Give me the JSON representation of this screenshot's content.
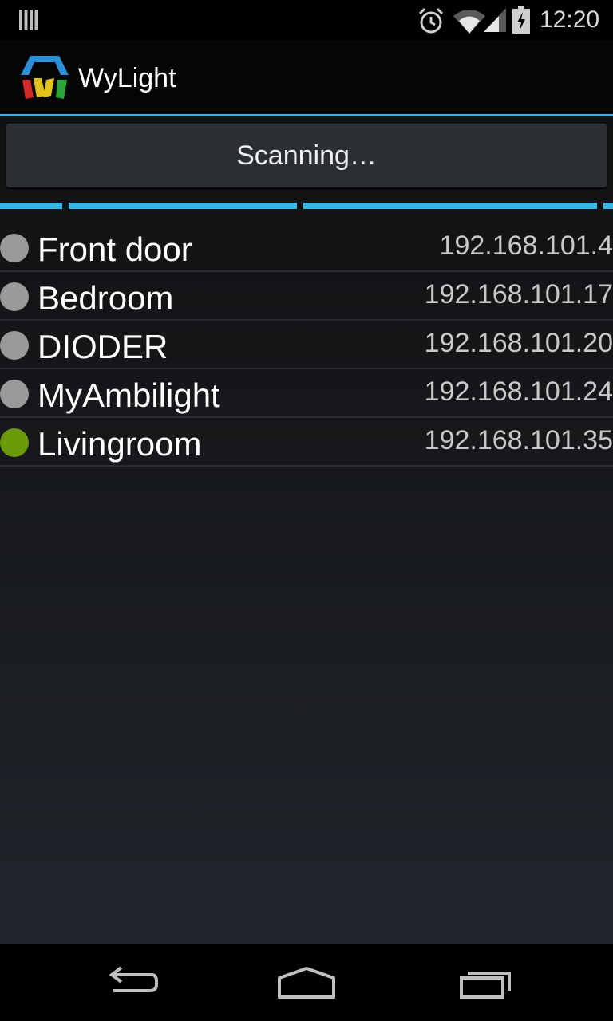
{
  "status_bar": {
    "time": "12:20",
    "icons": [
      "notification-bars-icon",
      "alarm-icon",
      "wifi-icon",
      "signal-icon",
      "battery-charging-icon"
    ]
  },
  "action_bar": {
    "title": "WyLight",
    "logo_icon": "wylight-logo-icon",
    "accent_color": "#33b5e5"
  },
  "scan_button": {
    "label": "Scanning…"
  },
  "progress": {
    "state": "indeterminate",
    "color": "#33b5e5"
  },
  "devices": [
    {
      "name": "Front door",
      "ip": "192.168.101.4",
      "status": "offline"
    },
    {
      "name": "Bedroom",
      "ip": "192.168.101.17",
      "status": "offline"
    },
    {
      "name": "DIODER",
      "ip": "192.168.101.20",
      "status": "offline"
    },
    {
      "name": "MyAmbilight",
      "ip": "192.168.101.24",
      "status": "offline"
    },
    {
      "name": "Livingroom",
      "ip": "192.168.101.35",
      "status": "online"
    }
  ],
  "status_colors": {
    "offline": "#9a9a9a",
    "online": "#6a9a0a"
  },
  "nav_bar": {
    "buttons": [
      "back-icon",
      "home-icon",
      "recents-icon"
    ]
  }
}
